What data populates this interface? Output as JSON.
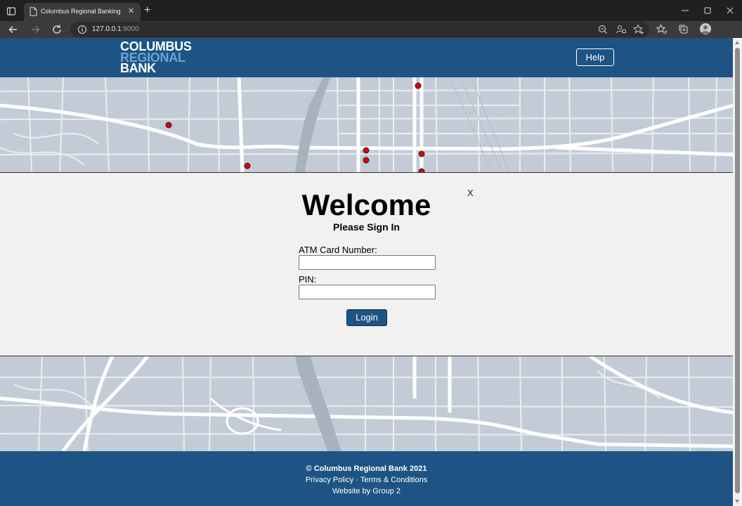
{
  "browser": {
    "tab_title": "Columbus Regional Banking",
    "url_host": "127.0.0.1",
    "url_port": ":8000"
  },
  "header": {
    "logo_line1": "COLUMBUS",
    "logo_line2": "REGIONAL",
    "logo_line3": "BANK",
    "help_label": "Help"
  },
  "modal": {
    "title": "Welcome",
    "subtitle": "Please Sign In",
    "close_label": "X",
    "card_label": "ATM Card Number:",
    "card_value": "",
    "pin_label": "PIN:",
    "pin_value": "",
    "login_label": "Login"
  },
  "footer": {
    "copyright": "© Columbus Regional Bank 2021",
    "privacy": "Privacy Policy",
    "separator": "·",
    "terms": "Terms & Conditions",
    "credit": "Website by Group 2"
  },
  "colors": {
    "brand": "#1d5483",
    "logo_accent": "#6fa3d6",
    "map_marker": "#e00000",
    "map_bg": "#c3ccd6"
  },
  "icons": [
    "tab-actions-icon",
    "page-icon",
    "close-icon",
    "plus-icon",
    "minimize-icon",
    "maximize-icon",
    "back-icon",
    "forward-icon",
    "refresh-icon",
    "info-icon",
    "zoom-icon",
    "tracking-icon",
    "favorite-add-icon",
    "favorites-icon",
    "collections-icon",
    "profile-icon"
  ]
}
